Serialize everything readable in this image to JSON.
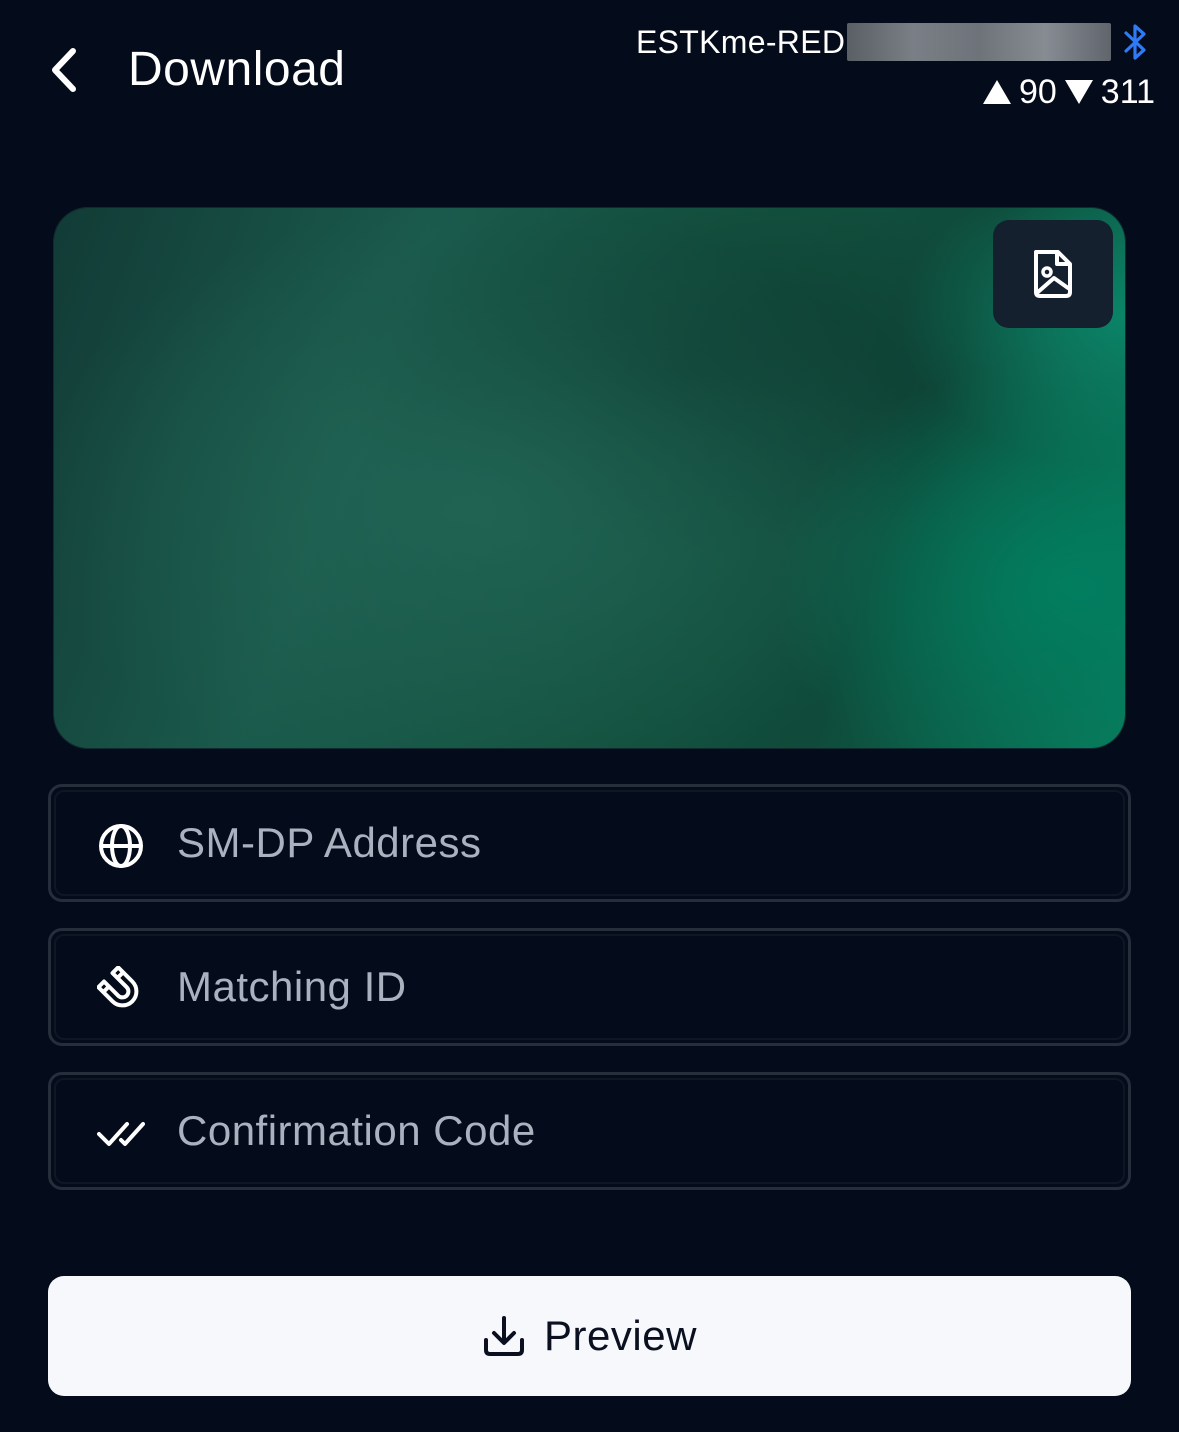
{
  "header": {
    "title": "Download",
    "back_icon": "chevron-left-icon",
    "device_name": "ESTKme-RED",
    "bluetooth_icon": "bluetooth-icon",
    "upload_count": "90",
    "download_count": "311"
  },
  "card": {
    "image_button_icon": "image-file-icon"
  },
  "fields": {
    "smdp": {
      "icon": "globe-icon",
      "placeholder": "SM-DP Address",
      "value": ""
    },
    "matching_id": {
      "icon": "magnet-icon",
      "placeholder": "Matching ID",
      "value": ""
    },
    "confirmation_code": {
      "icon": "double-check-icon",
      "placeholder": "Confirmation Code",
      "value": ""
    }
  },
  "preview_button": {
    "label": "Preview",
    "icon": "download-icon"
  },
  "colors": {
    "background": "#040b1a",
    "field_border": "#262e3b",
    "placeholder": "#aab2bf",
    "button_bg": "#f6f8fb",
    "bluetooth": "#2f7bf5"
  }
}
